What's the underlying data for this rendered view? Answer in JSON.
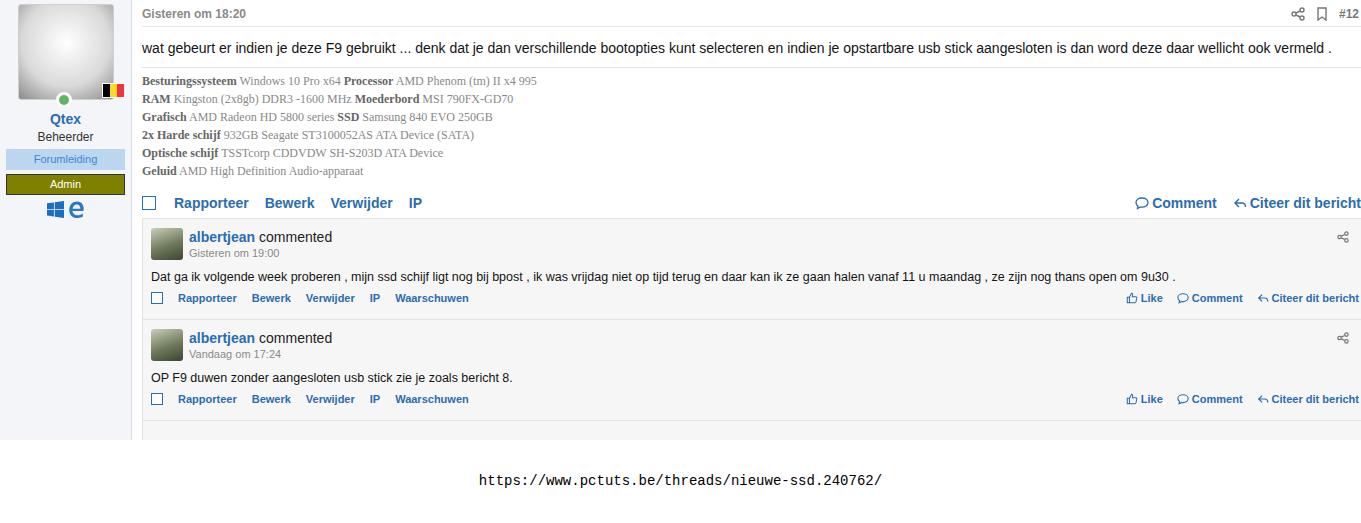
{
  "post": {
    "date": "Gisteren om 18:20",
    "number": "#12",
    "text": "wat gebeurt er indien je deze F9 gebruikt ... denk dat je dan verschillende bootopties kunt selecteren en indien je opstartbare usb stick aangesloten is dan word deze daar wellicht ook vermeld .",
    "author": {
      "name": "Qtex",
      "role": "Beheerder",
      "online": true,
      "badges": [
        {
          "label": "Forumleiding",
          "color": "#bcd6f0",
          "kind": "light"
        },
        {
          "label": "Admin",
          "color": "#7f7f00",
          "kind": "dark"
        }
      ]
    },
    "signature": [
      [
        {
          "label": "Besturingssysteem",
          "value": "Windows 10 Pro x64"
        },
        {
          "label": "Processor",
          "value": "AMD Phenom (tm) II x4 995"
        }
      ],
      [
        {
          "label": "RAM",
          "value": "Kingston (2x8gb) DDR3 -1600 MHz"
        },
        {
          "label": "Moederbord",
          "value": "MSI 790FX-GD70"
        }
      ],
      [
        {
          "label": "Grafisch",
          "value": "AMD Radeon HD 5800 series"
        },
        {
          "label": "SSD",
          "value": "Samsung 840 EVO 250GB"
        }
      ],
      [
        {
          "label": "2x Harde schijf",
          "value": "932GB Seagate ST3100052AS ATA Device (SATA)"
        }
      ],
      [
        {
          "label": "Optische schijf",
          "value": "TSSTcorp CDDVDW SH-S203D ATA Device"
        }
      ],
      [
        {
          "label": "Geluid",
          "value": "AMD High Definition Audio-apparaat"
        }
      ]
    ],
    "actions": [
      "Rapporteer",
      "Bewerk",
      "Verwijder",
      "IP"
    ],
    "right_actions": [
      {
        "label": "Comment",
        "kind": "comment"
      },
      {
        "label": "Citeer dit bericht",
        "kind": "quote"
      }
    ]
  },
  "comments": [
    {
      "author": "albertjean",
      "verb": "commented",
      "time": "Gisteren om 19:00",
      "text": "Dat ga ik volgende week proberen , mijn ssd schijf ligt nog bij bpost , ik was vrijdag niet op tijd terug en daar kan ik ze gaan halen vanaf 11 u maandag , ze zijn nog thans open om 9u30 .",
      "actions": [
        "Rapporteer",
        "Bewerk",
        "Verwijder",
        "IP",
        "Waarschuwen"
      ],
      "right_actions": [
        {
          "label": "Like",
          "kind": "like"
        },
        {
          "label": "Comment",
          "kind": "comment"
        },
        {
          "label": "Citeer dit bericht",
          "kind": "quote"
        }
      ]
    },
    {
      "author": "albertjean",
      "verb": "commented",
      "time": "Vandaag om 17:24",
      "text": "OP F9 duwen zonder aangesloten usb stick zie je zoals bericht 8.",
      "actions": [
        "Rapporteer",
        "Bewerk",
        "Verwijder",
        "IP",
        "Waarschuwen"
      ],
      "right_actions": [
        {
          "label": "Like",
          "kind": "like"
        },
        {
          "label": "Comment",
          "kind": "comment"
        },
        {
          "label": "Citeer dit bericht",
          "kind": "quote"
        }
      ]
    }
  ],
  "url": "https://www.pctuts.be/threads/nieuwe-ssd.240762/"
}
